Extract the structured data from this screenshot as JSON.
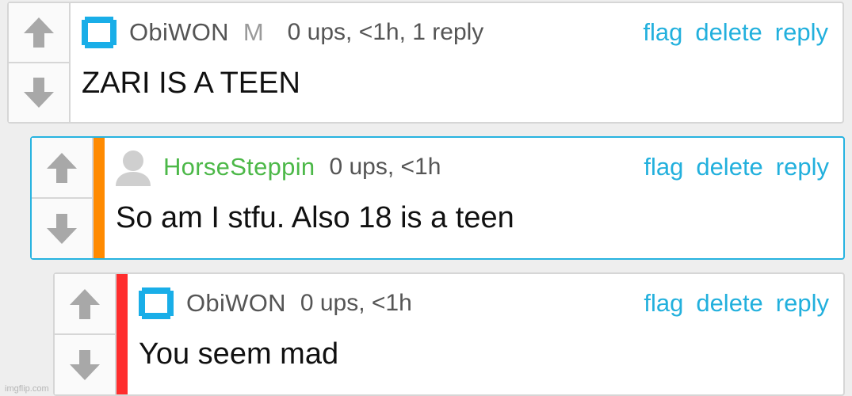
{
  "colors": {
    "accent": "#22b0dd",
    "username_default": "#555555",
    "username_green": "#4cb848",
    "depth_orange": "#ff8a00",
    "depth_red": "#ff2d2d"
  },
  "comments": [
    {
      "username": "ObiWON",
      "mod_badge": "M",
      "meta": "0 ups, <1h, 1 reply",
      "text": "ZARI IS A TEEN",
      "actions": {
        "flag": "flag",
        "delete": "delete",
        "reply": "reply"
      }
    },
    {
      "username": "HorseSteppin",
      "meta": "0 ups, <1h",
      "text": "So am I stfu. Also 18 is a teen",
      "actions": {
        "flag": "flag",
        "delete": "delete",
        "reply": "reply"
      }
    },
    {
      "username": "ObiWON",
      "meta": "0 ups, <1h",
      "text": "You seem mad",
      "actions": {
        "flag": "flag",
        "delete": "delete",
        "reply": "reply"
      }
    }
  ],
  "icons": {
    "upvote": "arrow-up-icon",
    "downvote": "arrow-down-icon",
    "avatar_square": "square-avatar-icon",
    "avatar_default": "default-user-icon"
  },
  "watermark": "imgflip.com"
}
